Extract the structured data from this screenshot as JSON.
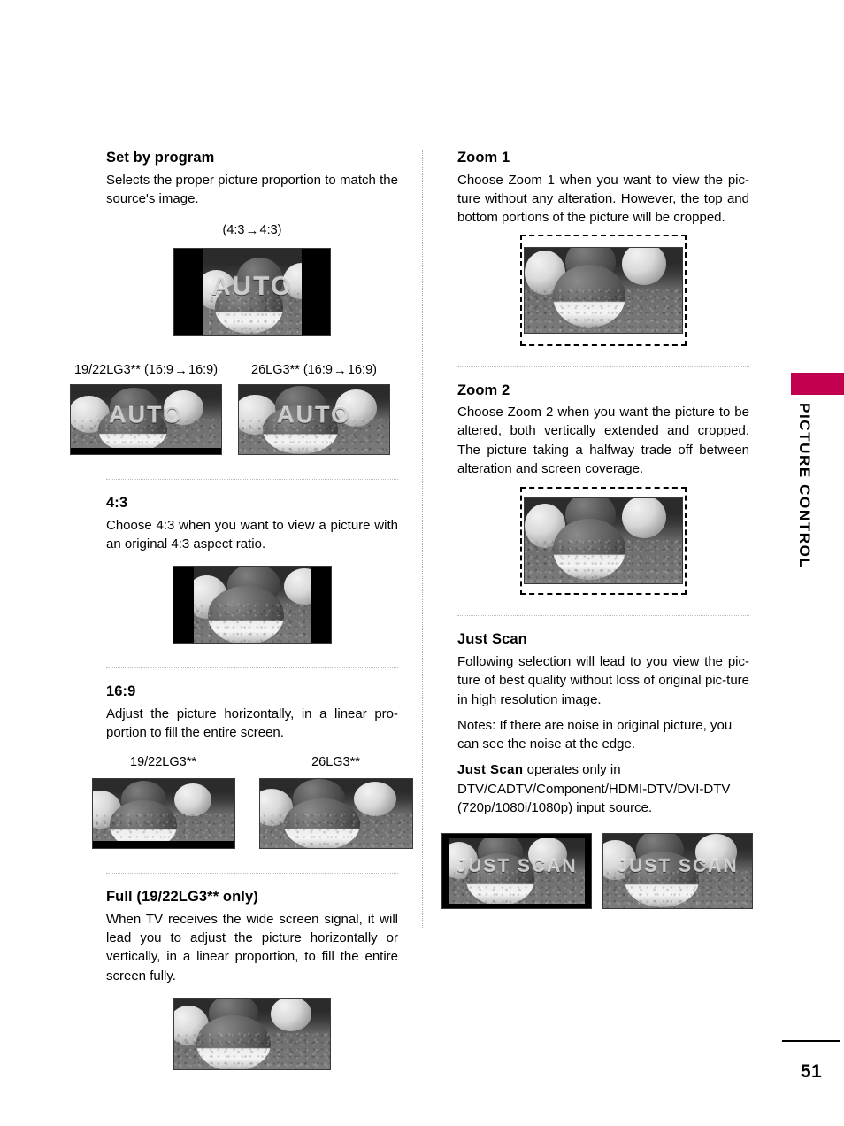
{
  "page": {
    "number": "51",
    "running_head": "PICTURE CONTROL",
    "tab_color": "#c2004f"
  },
  "left_column": {
    "sections": [
      {
        "id": "set-by-program",
        "title": "Set by program",
        "body": [
          "Selects the proper picture proportion to match the source's image."
        ],
        "figures": [
          {
            "id": "set-by-program-43",
            "caption_prefix": "(4:3",
            "caption_arrow": "→",
            "caption_suffix": "4:3)",
            "overlay": "AUTO"
          },
          {
            "id": "set-by-program-1922",
            "caption_prefix": "19/22LG3** (16:9",
            "caption_arrow": "→",
            "caption_suffix": "16:9)",
            "overlay": "AUTO"
          },
          {
            "id": "set-by-program-26",
            "caption_prefix": "26LG3** (16:9",
            "caption_arrow": "→",
            "caption_suffix": "16:9)",
            "overlay": "AUTO"
          }
        ]
      },
      {
        "id": "four-three",
        "title": "4:3",
        "body": [
          "Choose 4:3 when you want to view a picture with an original 4:3 aspect ratio."
        ]
      },
      {
        "id": "sixteen-nine",
        "title": "16:9",
        "body": [
          "Adjust the picture horizontally, in a linear pro-portion to fill the entire screen."
        ],
        "figures": [
          {
            "id": "sixteen-nine-1922",
            "caption": "19/22LG3**"
          },
          {
            "id": "sixteen-nine-26",
            "caption": "26LG3**"
          }
        ]
      },
      {
        "id": "full",
        "title": "Full (19/22LG3** only)",
        "body": [
          "When TV receives the wide screen signal, it will lead you to adjust the picture horizontally or vertically, in a linear proportion, to fill the entire screen fully."
        ]
      }
    ]
  },
  "right_column": {
    "sections": [
      {
        "id": "zoom-1",
        "title": "Zoom 1",
        "body": [
          "Choose Zoom 1 when you want to view the pic-ture without any alteration. However, the top and bottom portions of the picture will be cropped."
        ]
      },
      {
        "id": "zoom-2",
        "title": "Zoom 2",
        "body": [
          "Choose Zoom 2 when you want the picture to be altered, both vertically extended and cropped. The picture taking a halfway trade off between alteration and screen coverage."
        ]
      },
      {
        "id": "just-scan",
        "title": "Just Scan",
        "body": [
          "Following selection will lead to you view the pic-ture of best quality without loss of original pic-ture in high resolution image.",
          "Notes: If there are noise in original picture, you can see the noise at the edge."
        ],
        "note_bold": "Just Scan",
        "note_rest": " operates only in DTV/CADTV/Component/HDMI-DTV/DVI-DTV (720p/1080i/1080p) input source.",
        "figures": [
          {
            "id": "just-scan-left",
            "overlay": "JUST SCAN"
          },
          {
            "id": "just-scan-right",
            "overlay": "JUST SCAN"
          }
        ]
      }
    ]
  }
}
